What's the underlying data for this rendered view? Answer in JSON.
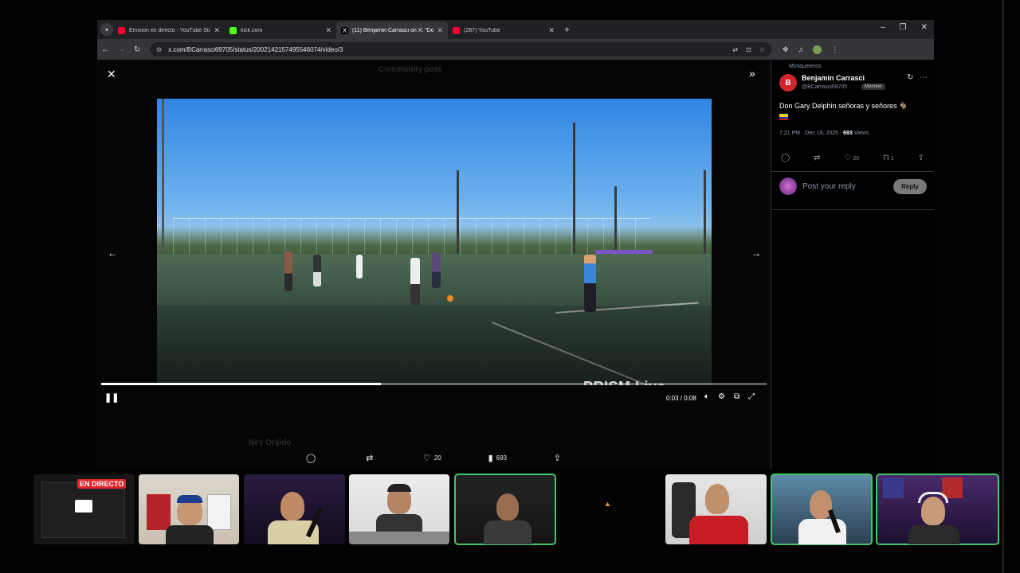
{
  "browser": {
    "tabs": [
      {
        "title": "Emisión en directo - YouTube Stu",
        "color": "#ff0033"
      },
      {
        "title": "kick.com",
        "color": "#53fc18"
      },
      {
        "title": "(11) Benjamin Carrasci on X: \"Don",
        "color": "#ffffff"
      },
      {
        "title": "(287) YouTube",
        "color": "#ff0033"
      }
    ],
    "new_tab": "+",
    "url": "x.com/BCarrasci69705/status/2002142157495546074/video/3"
  },
  "viewer": {
    "close": "✕",
    "expand": "»",
    "prev": "←",
    "next": "→",
    "watermark": "PRISM Live",
    "time": "0:03 / 0:08",
    "progress": 0.42,
    "play_state": "❚❚",
    "actions": {
      "reply_count": "",
      "repost_count": "",
      "like_count": "20",
      "views": "693"
    },
    "ghost_title": "Community post",
    "ghost_author": "Ney Orijido"
  },
  "tweet": {
    "community": "Mosqueteros",
    "avatar_letter": "B",
    "name": "Benjamin Carrasci",
    "handle": "@BCarrasci69705",
    "badge": "Member",
    "text": "Don Gary Delphin señoras y señores 🐐",
    "time": "7:21 PM · Dec 19, 2025 · ",
    "views_count": "693",
    "views_label": " Views",
    "likes": "20",
    "bookmarks": "1",
    "reply_placeholder": "Post your reply",
    "reply_button": "Reply"
  },
  "stream": {
    "live_label": "EN DIRECTO"
  }
}
